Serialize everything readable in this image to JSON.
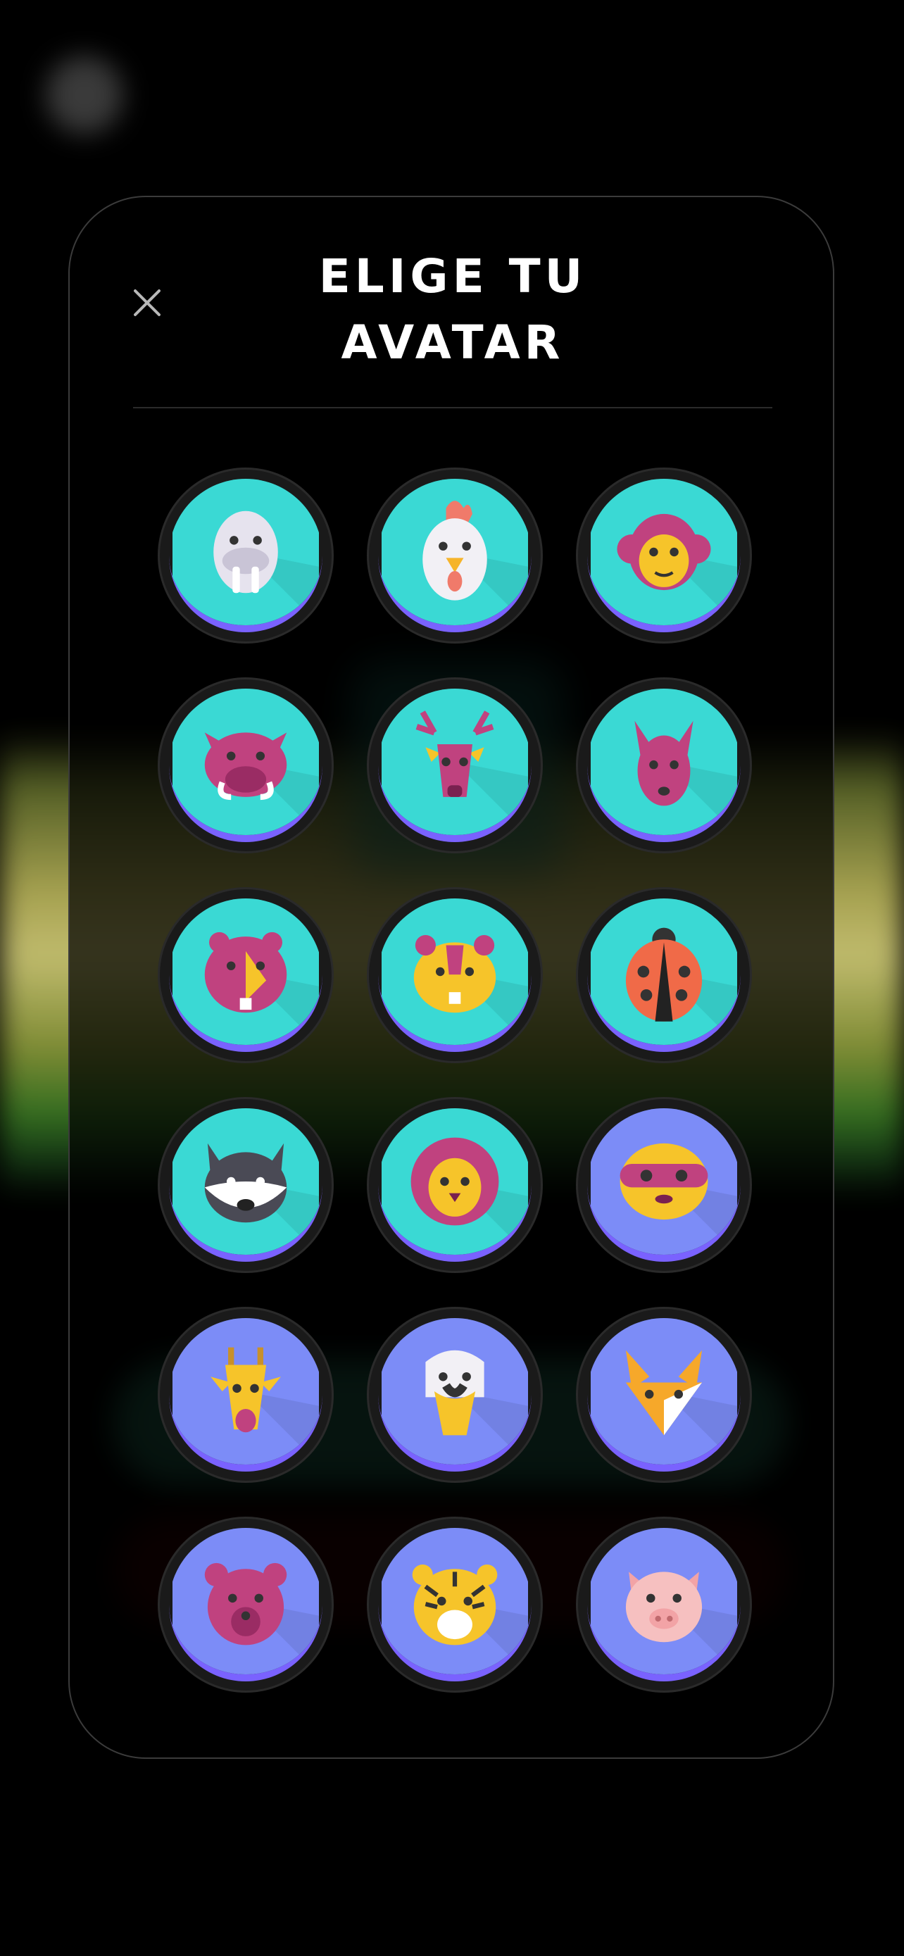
{
  "modal": {
    "title_line1": "ELIGE TU",
    "title_line2": "AVATAR"
  },
  "avatars": [
    {
      "name": "walrus",
      "bg": "#3ad9d4"
    },
    {
      "name": "rooster",
      "bg": "#3ad9d4"
    },
    {
      "name": "monkey",
      "bg": "#3ad9d4"
    },
    {
      "name": "boar",
      "bg": "#3ad9d4"
    },
    {
      "name": "deer",
      "bg": "#3ad9d4"
    },
    {
      "name": "kangaroo",
      "bg": "#3ad9d4"
    },
    {
      "name": "hamster",
      "bg": "#3ad9d4"
    },
    {
      "name": "chipmunk",
      "bg": "#3ad9d4"
    },
    {
      "name": "ladybug",
      "bg": "#3ad9d4"
    },
    {
      "name": "raccoon",
      "bg": "#3ad9d4"
    },
    {
      "name": "lion",
      "bg": "#3ad9d4"
    },
    {
      "name": "sloth",
      "bg": "#7c8cf7"
    },
    {
      "name": "giraffe",
      "bg": "#7c8cf7"
    },
    {
      "name": "eagle",
      "bg": "#7c8cf7"
    },
    {
      "name": "fox",
      "bg": "#7c8cf7"
    },
    {
      "name": "bear",
      "bg": "#7c8cf7"
    },
    {
      "name": "tiger",
      "bg": "#7c8cf7"
    },
    {
      "name": "pig",
      "bg": "#7c8cf7"
    }
  ],
  "colors": {
    "teal": "#3ad9d4",
    "periwinkle": "#7c8cf7",
    "ring_accent": "#7a62ff",
    "magenta": "#c0427f",
    "yellow": "#f6c42a"
  }
}
